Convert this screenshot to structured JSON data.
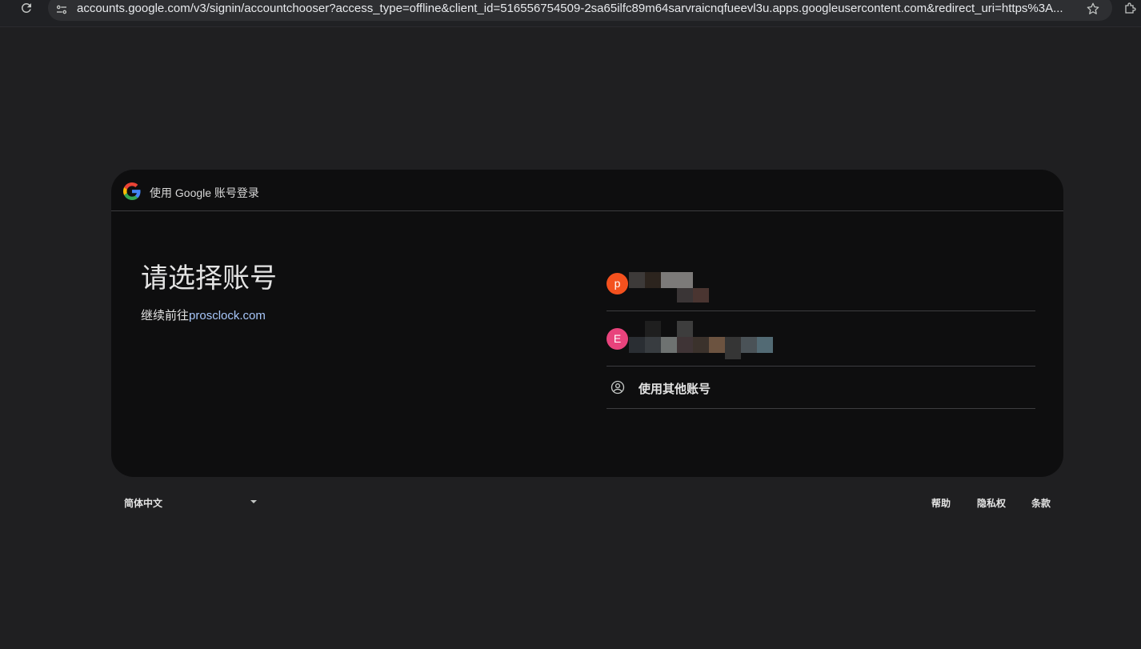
{
  "browser": {
    "url": "accounts.google.com/v3/signin/accountchooser?access_type=offline&client_id=516556754509-2sa65ilfc89m64sarvraicnqfueevl3u.apps.googleusercontent.com&redirect_uri=https%3A..."
  },
  "card": {
    "header_text": "使用 Google 账号登录",
    "title": "请选择账号",
    "subtitle_prefix": "继续前往",
    "subtitle_link": "prosclock.com"
  },
  "accounts": [
    {
      "initial": "p",
      "avatar_color": "#f4511e"
    },
    {
      "initial": "E",
      "avatar_color": "#e8437c"
    }
  ],
  "other_account_label": "使用其他账号",
  "footer": {
    "language": "简体中文",
    "help": "帮助",
    "privacy": "隐私权",
    "terms": "条款"
  },
  "colors": {
    "page_bg": "#1f1f21",
    "card_bg": "#0e0e0f",
    "link": "#a8c7fa"
  }
}
